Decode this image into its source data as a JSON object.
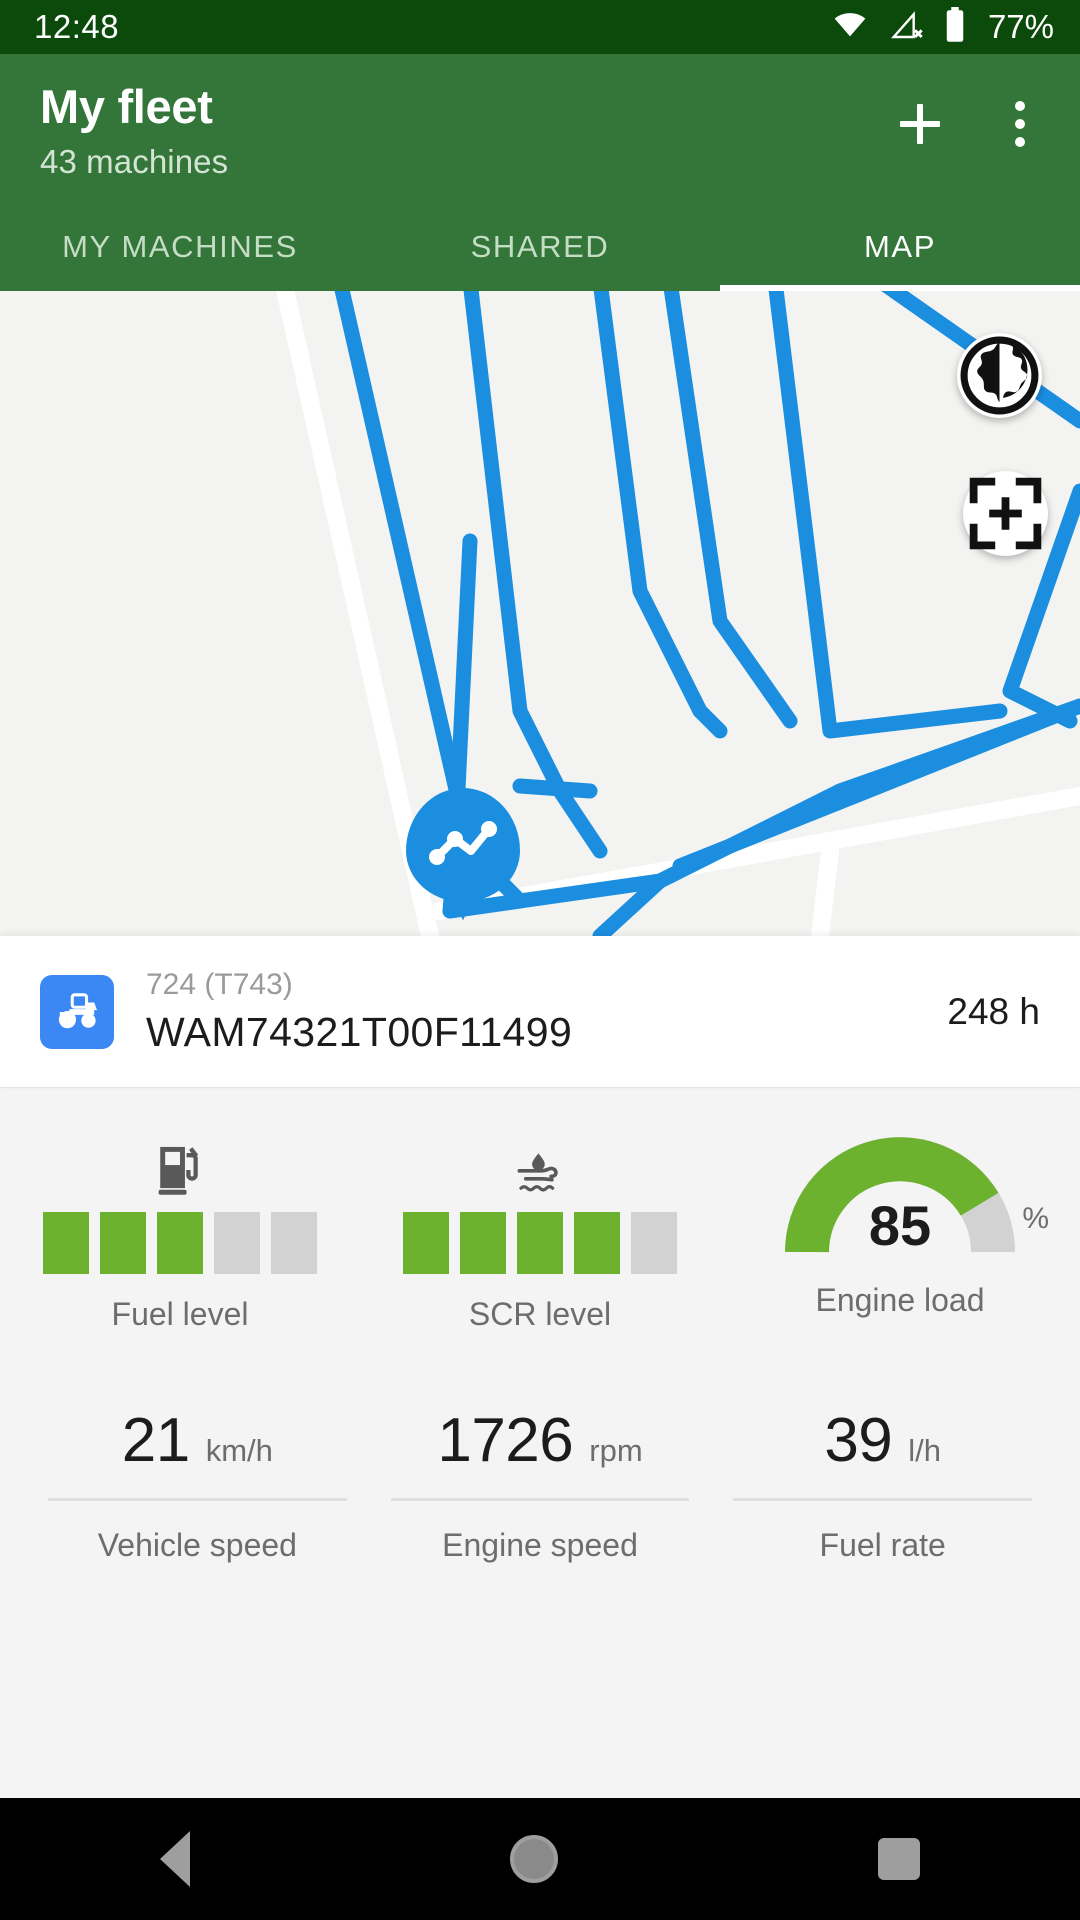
{
  "status_bar": {
    "time": "12:48",
    "battery_percent": "77%",
    "icons": [
      "wifi-icon",
      "cellular-off-icon",
      "battery-icon"
    ]
  },
  "app_bar": {
    "title": "My fleet",
    "subtitle": "43 machines",
    "actions": [
      {
        "name": "add-button",
        "icon": "plus-icon"
      },
      {
        "name": "overflow-menu-button",
        "icon": "more-vert-icon"
      }
    ],
    "tabs": [
      {
        "label": "MY MACHINES",
        "active": false
      },
      {
        "label": "SHARED",
        "active": false
      },
      {
        "label": "MAP",
        "active": true
      }
    ]
  },
  "map": {
    "track_color": "#1b8ee0",
    "background_color": "#f3f3f1",
    "road_color": "#ffffff",
    "controls": [
      {
        "name": "map-type-button",
        "icon": "globe-icon"
      },
      {
        "name": "recenter-button",
        "icon": "center-focus-icon"
      }
    ],
    "marker": {
      "icon": "activity-track-icon",
      "color": "#1b8ee0"
    }
  },
  "machine_card": {
    "icon": "tractor-icon",
    "icon_color": "#3b88f5",
    "model": "724 (T743)",
    "serial": "WAM74321T00F11499",
    "hours": "248 h"
  },
  "metrics": {
    "levels": [
      {
        "name": "fuel-level",
        "icon": "fuel-pump-icon",
        "label": "Fuel level",
        "segments_filled": 3,
        "segments_total": 5,
        "fill_color": "#6cb22e",
        "empty_color": "#d2d2d2"
      },
      {
        "name": "scr-level",
        "icon": "def-fluid-icon",
        "label": "SCR level",
        "segments_filled": 4,
        "segments_total": 5,
        "fill_color": "#6cb22e",
        "empty_color": "#d2d2d2"
      }
    ],
    "gauge": {
      "name": "engine-load",
      "label": "Engine load",
      "value": "85",
      "unit": "%",
      "percent": 85,
      "arc_color": "#6cb22e",
      "track_color": "#d2d2d2"
    },
    "stats": [
      {
        "name": "vehicle-speed",
        "value": "21",
        "unit": "km/h",
        "label": "Vehicle speed"
      },
      {
        "name": "engine-speed",
        "value": "1726",
        "unit": "rpm",
        "label": "Engine speed"
      },
      {
        "name": "fuel-rate",
        "value": "39",
        "unit": "l/h",
        "label": "Fuel rate"
      }
    ]
  },
  "nav_bar": {
    "buttons": [
      {
        "name": "nav-back-button",
        "icon": "back-triangle-icon"
      },
      {
        "name": "nav-home-button",
        "icon": "home-circle-icon"
      },
      {
        "name": "nav-recents-button",
        "icon": "recents-square-icon"
      }
    ]
  }
}
